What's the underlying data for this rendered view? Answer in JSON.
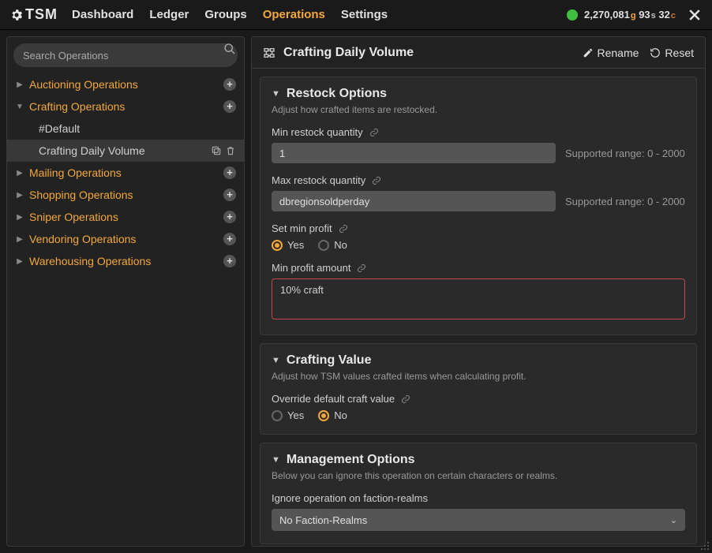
{
  "app": {
    "name": "TSM"
  },
  "nav": {
    "items": [
      "Dashboard",
      "Ledger",
      "Groups",
      "Operations",
      "Settings"
    ],
    "active": "Operations"
  },
  "status": {
    "gold": "2,270,081",
    "silver": "93",
    "copper": "32"
  },
  "sidebar": {
    "search_placeholder": "Search Operations",
    "categories": [
      {
        "label": "Auctioning Operations",
        "expanded": false
      },
      {
        "label": "Crafting Operations",
        "expanded": true,
        "children": [
          {
            "label": "#Default",
            "selected": false
          },
          {
            "label": "Crafting Daily Volume",
            "selected": true
          }
        ]
      },
      {
        "label": "Mailing Operations",
        "expanded": false
      },
      {
        "label": "Shopping Operations",
        "expanded": false
      },
      {
        "label": "Sniper Operations",
        "expanded": false
      },
      {
        "label": "Vendoring Operations",
        "expanded": false
      },
      {
        "label": "Warehousing Operations",
        "expanded": false
      }
    ]
  },
  "main": {
    "title": "Crafting Daily Volume",
    "rename_label": "Rename",
    "reset_label": "Reset",
    "sections": {
      "restock": {
        "title": "Restock Options",
        "desc": "Adjust how crafted items are restocked.",
        "min_restock_label": "Min restock quantity",
        "min_restock_value": "1",
        "min_restock_hint": "Supported range: 0 - 2000",
        "max_restock_label": "Max restock quantity",
        "max_restock_value": "dbregionsoldperday",
        "max_restock_hint": "Supported range: 0 - 2000",
        "set_min_profit_label": "Set min profit",
        "set_min_profit_value": "Yes",
        "yes": "Yes",
        "no": "No",
        "min_profit_amount_label": "Min profit amount",
        "min_profit_amount_value": "10% craft"
      },
      "crafting_value": {
        "title": "Crafting Value",
        "desc": "Adjust how TSM values crafted items when calculating profit.",
        "override_label": "Override default craft value",
        "override_value": "No",
        "yes": "Yes",
        "no": "No"
      },
      "management": {
        "title": "Management Options",
        "desc": "Below you can ignore this operation on certain characters or realms.",
        "ignore_label": "Ignore operation on faction-realms",
        "ignore_value": "No Faction-Realms"
      }
    }
  }
}
